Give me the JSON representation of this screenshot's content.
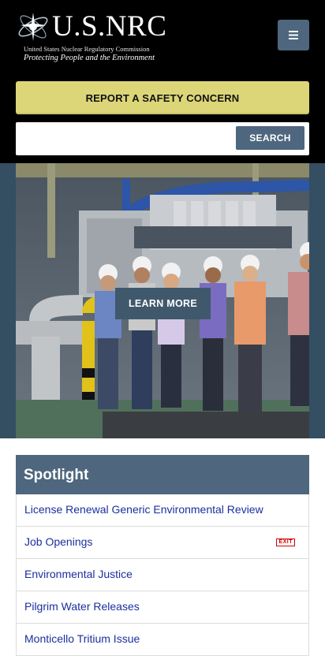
{
  "header": {
    "logo_title": "U.S.NRC",
    "logo_subtitle": "United States Nuclear Regulatory Commission",
    "logo_tagline": "Protecting People and the Environment",
    "menu_icon": "hamburger-icon",
    "report_label": "REPORT A SAFETY CONCERN",
    "search_placeholder": "",
    "search_label": "SEARCH",
    "colors": {
      "header_bg": "#000000",
      "accent_button": "#4e677e",
      "report_button": "#dcd679"
    }
  },
  "hero": {
    "learn_more_label": "LEARN MORE"
  },
  "spotlight": {
    "title": "Spotlight",
    "items": [
      {
        "label": "License Renewal Generic Environmental Review",
        "exit": ""
      },
      {
        "label": "Job Openings",
        "exit": "EXIT"
      },
      {
        "label": "Environmental Justice",
        "exit": ""
      },
      {
        "label": "Pilgrim Water Releases",
        "exit": ""
      },
      {
        "label": "Monticello Tritium Issue",
        "exit": ""
      }
    ]
  }
}
